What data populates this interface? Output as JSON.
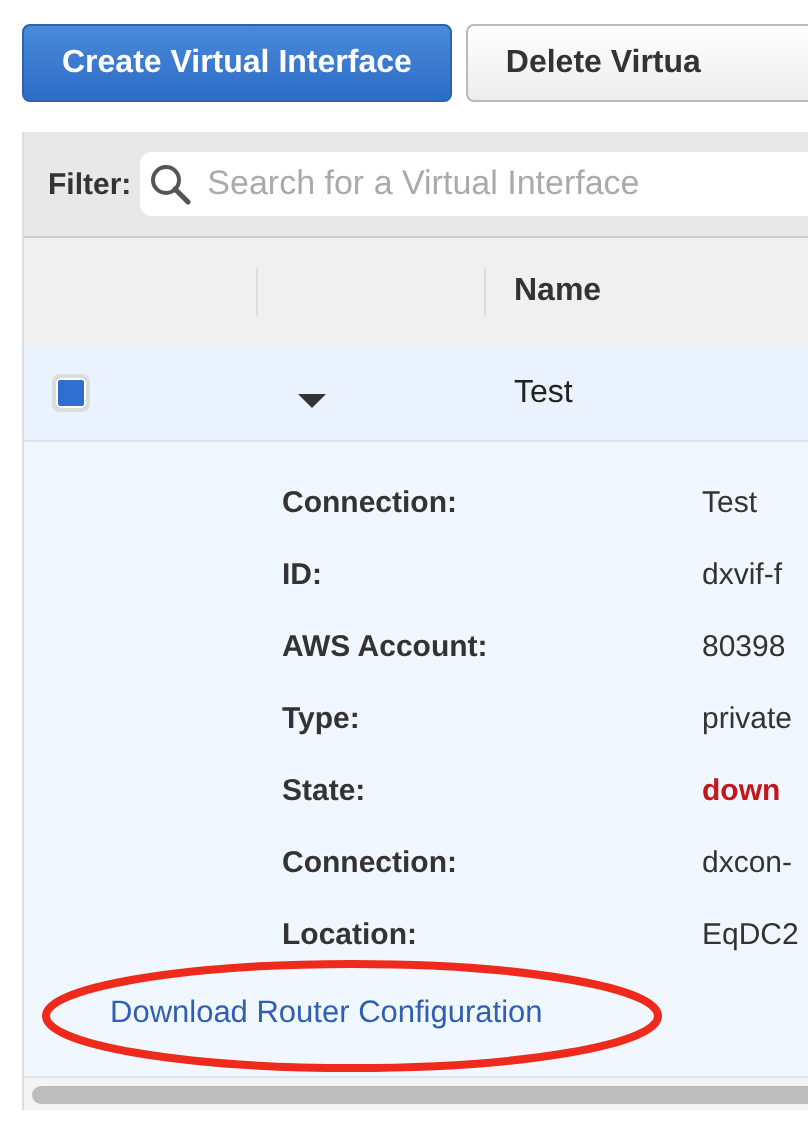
{
  "toolbar": {
    "buttons": [
      {
        "label": "Create Virtual Interface",
        "kind": "primary"
      },
      {
        "label": "Delete Virtua",
        "kind": "secondary"
      }
    ]
  },
  "filter": {
    "label": "Filter:",
    "placeholder": "Search for a Virtual Interface"
  },
  "table": {
    "columns": [
      "Name"
    ],
    "rows": [
      {
        "name": "Test",
        "selected": true,
        "expanded": true,
        "details": [
          {
            "label": "Connection:",
            "value": "Test",
            "kind": "plain"
          },
          {
            "label": "ID:",
            "value": "dxvif-f",
            "kind": "plain"
          },
          {
            "label": "AWS Account:",
            "value": "80398",
            "kind": "plain"
          },
          {
            "label": "Type:",
            "value": "private",
            "kind": "plain"
          },
          {
            "label": "State:",
            "value": "down",
            "kind": "alert"
          },
          {
            "label": "Connection:",
            "value": "dxcon-",
            "kind": "plain"
          },
          {
            "label": "Location:",
            "value": "EqDC2",
            "kind": "plain"
          }
        ],
        "link": {
          "text": "Download Router Configuration",
          "circled": true
        }
      }
    ]
  }
}
